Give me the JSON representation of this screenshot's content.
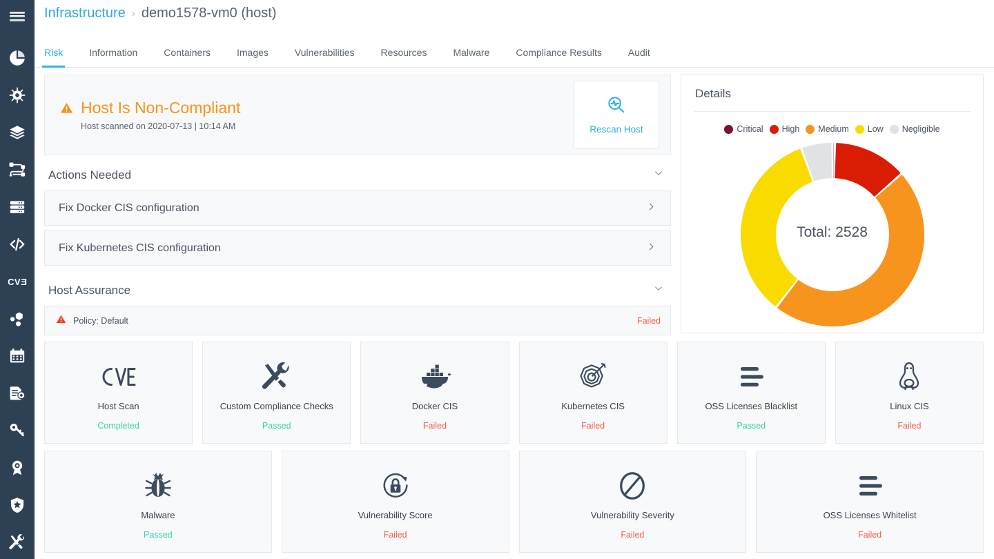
{
  "sidebar": {
    "menu_icon": "hamburger-menu-icon",
    "items": [
      {
        "icon": "pie-chart-icon",
        "name": "dashboard"
      },
      {
        "icon": "bug-virus-icon",
        "name": "risk-explorer"
      },
      {
        "icon": "layers-icon",
        "name": "images"
      },
      {
        "icon": "pipeline-icon",
        "name": "pipelines"
      },
      {
        "icon": "server-stack-icon",
        "name": "infrastructure"
      },
      {
        "icon": "code-brackets-icon",
        "name": "code"
      },
      {
        "icon": "cve-icon",
        "name": "cve-database",
        "label": "CVE"
      },
      {
        "icon": "nodes-cluster-icon",
        "name": "clusters"
      },
      {
        "icon": "calendar-icon",
        "name": "scan-schedule"
      },
      {
        "icon": "document-gear-icon",
        "name": "policies"
      },
      {
        "icon": "key-icon",
        "name": "secrets"
      },
      {
        "icon": "award-badge-icon",
        "name": "assurance"
      },
      {
        "icon": "shield-star-icon",
        "name": "security"
      },
      {
        "icon": "tools-icon",
        "name": "administration"
      }
    ]
  },
  "breadcrumb": {
    "root": "Infrastructure",
    "separator": "›",
    "current": "demo1578-vm0 (host)"
  },
  "tabs": [
    {
      "label": "Risk",
      "active": true
    },
    {
      "label": "Information",
      "active": false
    },
    {
      "label": "Containers",
      "active": false
    },
    {
      "label": "Images",
      "active": false
    },
    {
      "label": "Vulnerabilities",
      "active": false
    },
    {
      "label": "Resources",
      "active": false
    },
    {
      "label": "Malware",
      "active": false
    },
    {
      "label": "Compliance Results",
      "active": false
    },
    {
      "label": "Audit",
      "active": false
    }
  ],
  "banner": {
    "icon": "warning-triangle-icon",
    "title": "Host Is Non-Compliant",
    "subtitle": "Host scanned on 2020-07-13 | 10:14 AM",
    "rescan_icon": "magnifier-pulse-icon",
    "rescan_label": "Rescan Host"
  },
  "actions_needed": {
    "title": "Actions Needed",
    "collapse_icon": "chevron-down-icon",
    "items": [
      {
        "label": "Fix Docker CIS configuration",
        "chevron": "chevron-right-icon"
      },
      {
        "label": "Fix Kubernetes CIS configuration",
        "chevron": "chevron-right-icon"
      }
    ]
  },
  "host_assurance": {
    "title": "Host Assurance",
    "collapse_icon": "chevron-down-icon",
    "policy": {
      "icon": "warning-triangle-icon",
      "label": "Policy: Default",
      "status": "Failed"
    }
  },
  "details": {
    "title": "Details"
  },
  "chart_data": {
    "type": "pie",
    "title": "Details",
    "total_label": "Total: 2528",
    "total": 2528,
    "legend_position": "top",
    "categories": [
      "Critical",
      "High",
      "Medium",
      "Low",
      "Negligible"
    ],
    "values": [
      11,
      330,
      1188,
      859,
      140
    ],
    "colors": [
      "#7b1239",
      "#da1c05",
      "#f7941e",
      "#fadb00",
      "#e0e2e3"
    ],
    "series": [
      {
        "name": "Critical",
        "value": 11,
        "color": "#7b1239",
        "percent": 0.4
      },
      {
        "name": "High",
        "value": 330,
        "color": "#da1c05",
        "percent": 13.1
      },
      {
        "name": "Medium",
        "value": 1188,
        "color": "#f7941e",
        "percent": 47.0
      },
      {
        "name": "Low",
        "value": 859,
        "color": "#fadb00",
        "percent": 34.0
      },
      {
        "name": "Negligible",
        "value": 140,
        "color": "#e0e2e3",
        "percent": 5.5
      }
    ]
  },
  "status_cards": {
    "row1": [
      {
        "icon": "cve-icon",
        "title": "Host Scan",
        "status": "Completed",
        "state": "pass"
      },
      {
        "icon": "hammer-wrench-icon",
        "title": "Custom Compliance Checks",
        "status": "Passed",
        "state": "pass"
      },
      {
        "icon": "docker-whale-icon",
        "title": "Docker CIS",
        "status": "Failed",
        "state": "fail"
      },
      {
        "icon": "target-arrow-icon",
        "title": "Kubernetes CIS",
        "status": "Failed",
        "state": "fail"
      },
      {
        "icon": "list-lines-icon",
        "title": "OSS Licenses Blacklist",
        "status": "Passed",
        "state": "pass"
      },
      {
        "icon": "linux-penguin-icon",
        "title": "Linux CIS",
        "status": "Failed",
        "state": "fail"
      }
    ],
    "row2": [
      {
        "icon": "bug-icon",
        "title": "Malware",
        "status": "Passed",
        "state": "pass"
      },
      {
        "icon": "lock-cycle-icon",
        "title": "Vulnerability Score",
        "status": "Failed",
        "state": "fail"
      },
      {
        "icon": "no-entry-icon",
        "title": "Vulnerability Severity",
        "status": "Failed",
        "state": "fail"
      },
      {
        "icon": "list-lines-icon",
        "title": "OSS Licenses Whitelist",
        "status": "Failed",
        "state": "fail"
      }
    ]
  },
  "colors": {
    "accent": "#2bb4e0",
    "sidebar_bg": "#2e4054",
    "warning": "#f7941e",
    "pass": "#3ecfb2",
    "fail": "#f4604c",
    "text": "#4a5462"
  }
}
